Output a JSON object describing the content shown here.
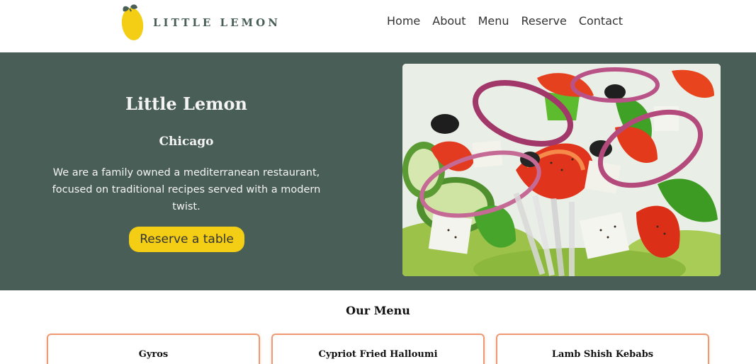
{
  "brand": {
    "logo_text": "LITTLE LEMON",
    "primary_color": "#495e57",
    "accent_color": "#f4ce14",
    "card_border_color": "#ee9972"
  },
  "nav": {
    "items": [
      {
        "label": "Home"
      },
      {
        "label": "About"
      },
      {
        "label": "Menu"
      },
      {
        "label": "Reserve"
      },
      {
        "label": "Contact"
      }
    ]
  },
  "hero": {
    "title": "Little Lemon",
    "city": "Chicago",
    "description": "We are a family owned a mediterranean restaurant, focused on traditional recipes served with a modern twist.",
    "cta_label": "Reserve a table",
    "image_subject": "greek-salad"
  },
  "menu": {
    "title": "Our Menu",
    "items": [
      {
        "name": "Gyros"
      },
      {
        "name": "Cypriot Fried Halloumi"
      },
      {
        "name": "Lamb Shish Kebabs"
      }
    ]
  }
}
